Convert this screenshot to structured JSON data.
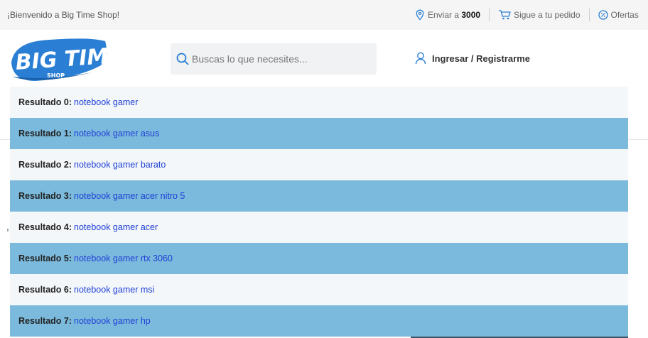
{
  "topbar": {
    "welcome": "¡Bienvenido a Big Time Shop!",
    "ship_prefix": "Enviar a",
    "ship_zip": "3000",
    "track_order": "Sigue a tu pedido",
    "offers": "Ofertas"
  },
  "logo": {
    "line1": "BIG TIME",
    "line2": "SHOP"
  },
  "search": {
    "placeholder": "Buscas lo que necesites..."
  },
  "account": {
    "login_label": "Ingresar / Registrarme"
  },
  "colors": {
    "accent": "#2a7fd4",
    "result_alt_bg": "#7bbadc",
    "result_link": "#1f3fd6"
  },
  "results": [
    {
      "label": "Resultado 0:",
      "term": "notebook gamer"
    },
    {
      "label": "Resultado 1:",
      "term": "notebook gamer asus"
    },
    {
      "label": "Resultado 2:",
      "term": "notebook gamer barato"
    },
    {
      "label": "Resultado 3:",
      "term": "notebook gamer acer nitro 5"
    },
    {
      "label": "Resultado 4:",
      "term": "notebook gamer acer"
    },
    {
      "label": "Resultado 5:",
      "term": "notebook gamer rtx 3060"
    },
    {
      "label": "Resultado 6:",
      "term": "notebook gamer msi"
    },
    {
      "label": "Resultado 7:",
      "term": "notebook gamer hp"
    }
  ]
}
